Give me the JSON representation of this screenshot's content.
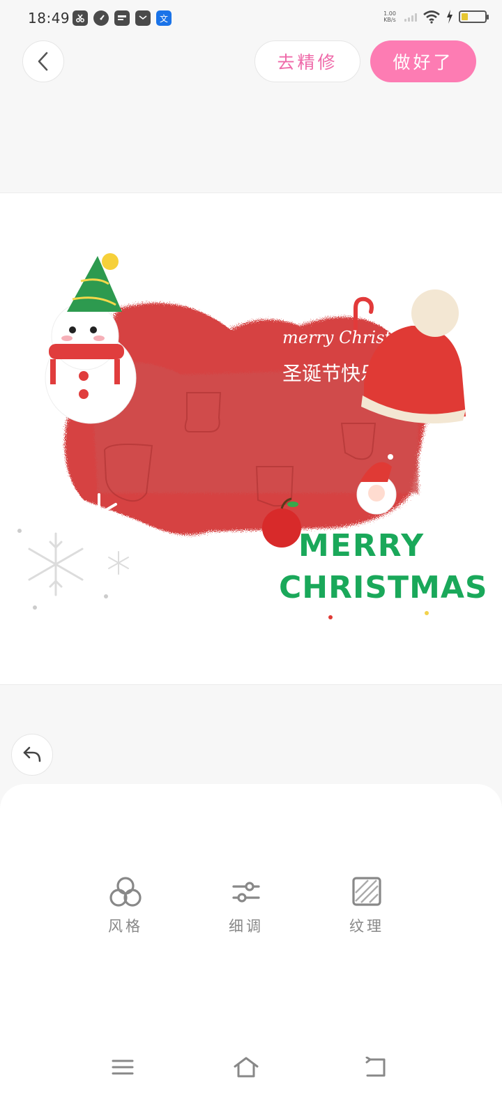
{
  "status_bar": {
    "time": "18:49",
    "net_speed_value": "1.00",
    "net_speed_unit": "KB/s",
    "app_icons": [
      "scissors-icon",
      "gauge-icon",
      "card-icon",
      "mail-icon",
      "translate-icon"
    ],
    "translate_glyph": "文"
  },
  "header": {
    "refine_label": "去精修",
    "done_label": "做好了"
  },
  "artwork": {
    "script_text_1": "merry Christmas",
    "script_text_2": "圣诞节快乐",
    "title_line_1": "MERRY",
    "title_line_2": "CHRISTMAS"
  },
  "tools": [
    {
      "label": "风格",
      "icon": "three-circles-icon"
    },
    {
      "label": "细调",
      "icon": "sliders-icon"
    },
    {
      "label": "纹理",
      "icon": "texture-icon"
    }
  ],
  "colors": {
    "accent": "#fd7cb3",
    "accent_text": "#ef6aa9",
    "card_red": "#d94a4a",
    "christmas_green": "#1aa85a"
  }
}
